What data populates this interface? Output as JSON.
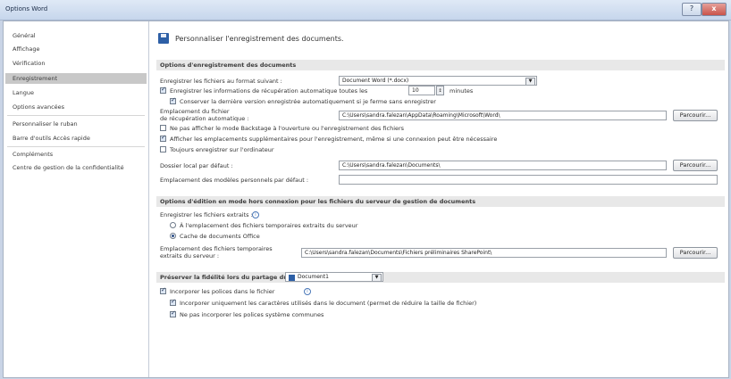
{
  "window": {
    "title": "Options Word",
    "help_glyph": "?",
    "close_glyph": "x"
  },
  "nav": {
    "items": [
      "Général",
      "Affichage",
      "Vérification",
      "Enregistrement",
      "Langue",
      "Options avancées",
      "Personnaliser le ruban",
      "Barre d'outils Accès rapide",
      "Compléments",
      "Centre de gestion de la confidentialité"
    ],
    "selected": "Enregistrement"
  },
  "header": {
    "title": "Personnaliser l'enregistrement des documents."
  },
  "save_section": {
    "title": "Options d'enregistrement des documents",
    "format_label": "Enregistrer les fichiers au format suivant :",
    "format_value": "Document Word (*.docx)",
    "autorecover_label": "Enregistrer les informations de récupération automatique toutes les",
    "autorecover_minutes": "10",
    "minutes_label": "minutes",
    "keep_last_label": "Conserver la dernière version enregistrée automatiquement si je ferme sans enregistrer",
    "recovery_location_label_1": "Emplacement du fichier",
    "recovery_location_label_2": "de récupération automatique :",
    "recovery_location_value": "C:\\Users\\sandra.falezan\\AppData\\Roaming\\Microsoft\\Word\\",
    "browse_label": "Parcourir...",
    "backstage_label": "Ne pas afficher le mode Backstage à l'ouverture ou l'enregistrement des fichiers",
    "show_locations_label": "Afficher les emplacements supplémentaires pour l'enregistrement, même si une connexion peut être nécessaire",
    "save_computer_label": "Toujours enregistrer sur l'ordinateur",
    "default_local_label": "Dossier local par défaut :",
    "default_local_value": "C:\\Users\\sandra.falezan\\Documents\\",
    "templates_label": "Emplacement des modèles personnels par défaut :",
    "templates_value": "",
    "states": {
      "autorecover": true,
      "keep_last": true,
      "backstage": false,
      "show_locations": true,
      "save_computer": false
    }
  },
  "offline_section": {
    "title": "Options d'édition en mode hors connexion pour les fichiers du serveur de gestion de documents",
    "save_checked_out_label": "Enregistrer les fichiers extraits :",
    "info_glyph": "i",
    "option_server": "À l'emplacement des fichiers temporaires extraits du serveur",
    "option_cache": "Cache de documents Office",
    "selected": "option_cache",
    "drafts_label_1": "Emplacement des fichiers temporaires",
    "drafts_label_2": "extraits du serveur :",
    "drafts_value": "C:\\Users\\sandra.falezan\\Documents\\Fichiers préliminaires SharePoint\\",
    "browse_label": "Parcourir..."
  },
  "fidelity_section": {
    "title": "Préserver la fidélité lors du partage du document :",
    "document_value": "Document1",
    "embed_fonts_label": "Incorporer les polices dans le fichier",
    "embed_used_label": "Incorporer uniquement les caractères utilisés dans le document (permet de réduire la taille de fichier)",
    "no_system_fonts_label": "Ne pas incorporer les polices système communes",
    "states": {
      "embed_fonts": true,
      "embed_used": true,
      "no_system_fonts": true
    }
  },
  "dropdown_glyph": "▼",
  "spin_glyph": "↕",
  "colors": {
    "selected_nav": "#c8c8c8",
    "section_header": "#e8e8e8",
    "titlebar": "#c6d6ec",
    "accent": "#2d5fa6"
  }
}
